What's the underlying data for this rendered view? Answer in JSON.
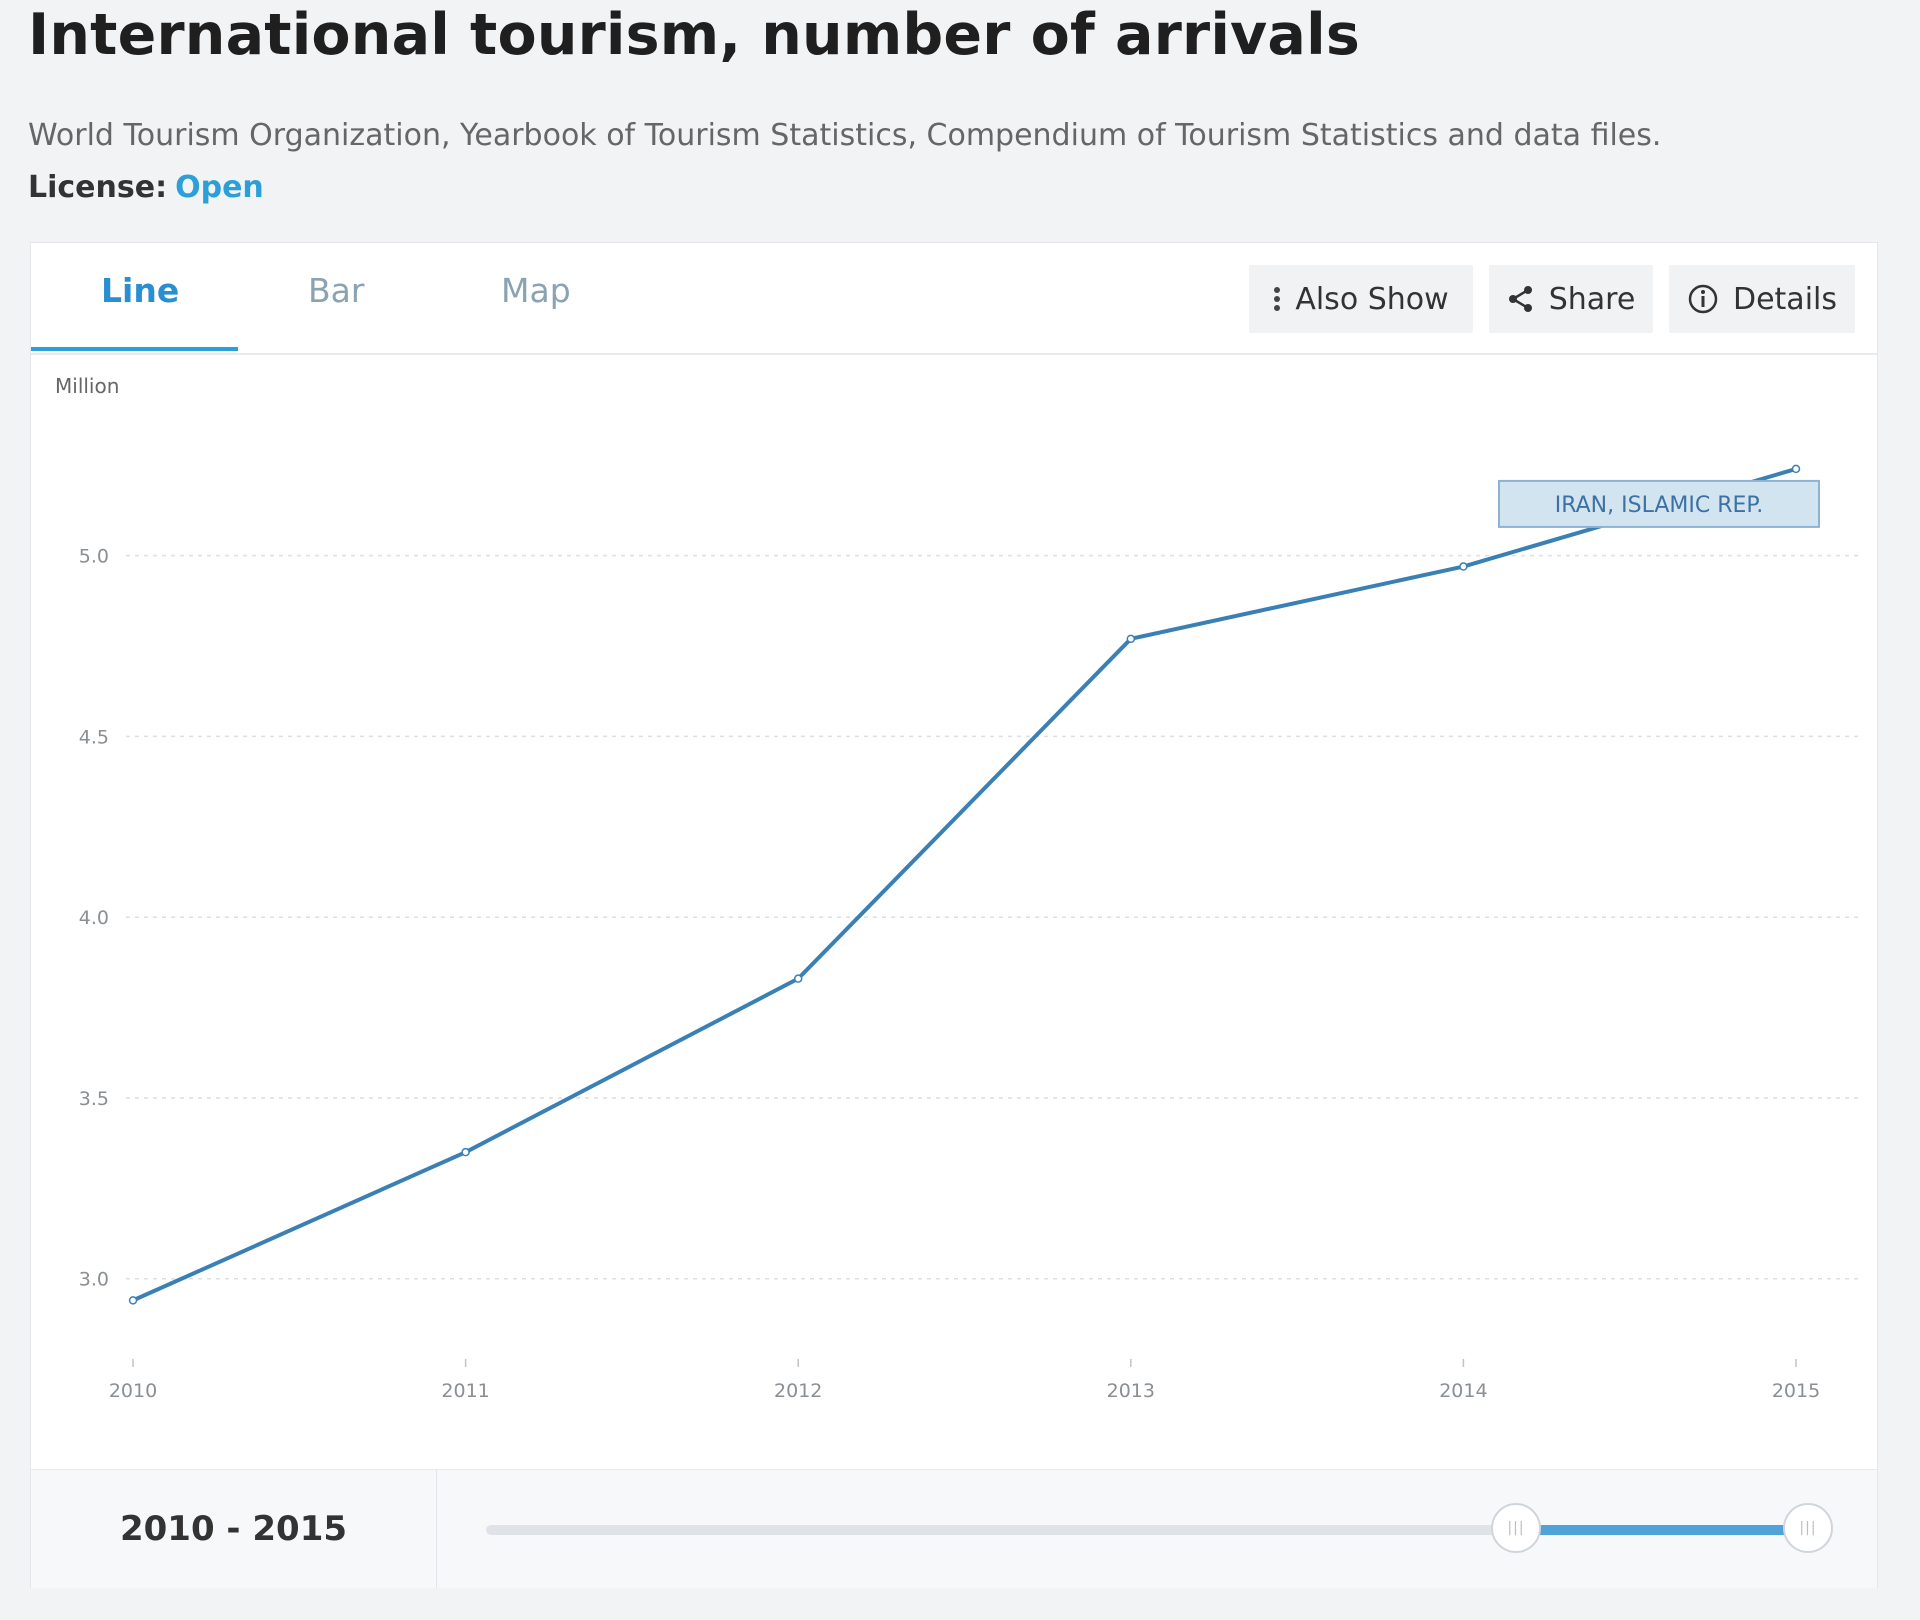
{
  "header": {
    "title": "International tourism, number of arrivals",
    "source": "World Tourism Organization, Yearbook of Tourism Statistics, Compendium of Tourism Statistics and data files.",
    "license_label": "License:",
    "license_value": "Open"
  },
  "tabs": [
    {
      "label": "Line",
      "active": true
    },
    {
      "label": "Bar",
      "active": false
    },
    {
      "label": "Map",
      "active": false
    }
  ],
  "toolbar": {
    "also_show": "Also Show",
    "share": "Share",
    "details": "Details"
  },
  "range": {
    "label": "2010 - 2015",
    "start_year": 2010,
    "end_year": 2015
  },
  "colors": {
    "line": "#3a80b5",
    "accent": "#2a9fd8",
    "label_bg": "#d3e4f1",
    "label_border": "#8fb3cf",
    "label_text": "#3b72a3"
  },
  "chart_data": {
    "type": "line",
    "title": "",
    "ylabel": "Million",
    "xlabel": "",
    "x": [
      2010,
      2011,
      2012,
      2013,
      2014,
      2015
    ],
    "ylim": [
      2.8,
      5.45
    ],
    "yticks": [
      3.0,
      3.5,
      4.0,
      4.5,
      5.0
    ],
    "grid": true,
    "series": [
      {
        "name": "IRAN, ISLAMIC REP.",
        "values": [
          2.94,
          3.35,
          3.83,
          4.77,
          4.97,
          5.24
        ]
      }
    ]
  }
}
